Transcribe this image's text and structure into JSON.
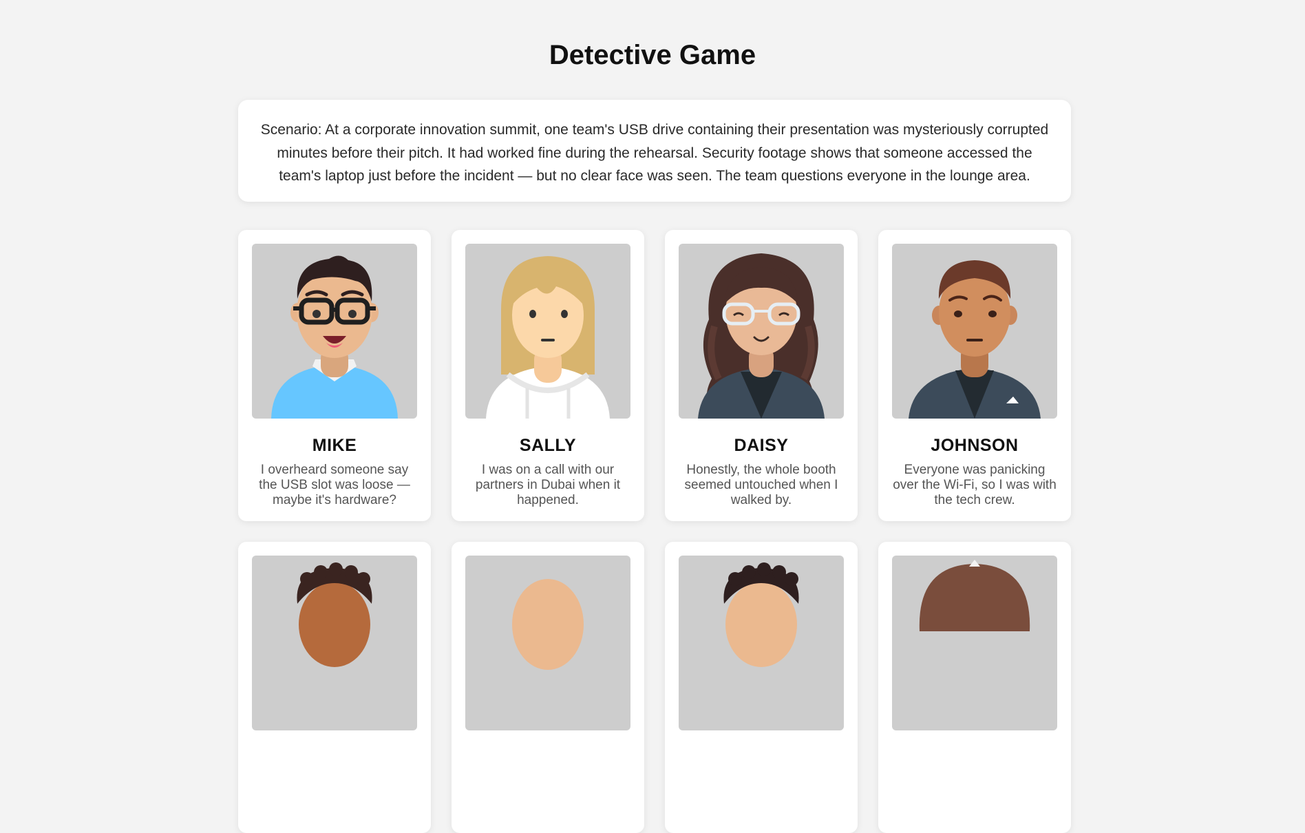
{
  "title": "Detective Game",
  "scenario": "Scenario: At a corporate innovation summit, one team's USB drive containing their presentation was mysteriously corrupted minutes before their pitch. It had worked fine during the rehearsal. Security footage shows that someone accessed the team's laptop just before the incident — but no clear face was seen. The team questions everyone in the lounge area.",
  "suspects": [
    {
      "name": "MIKE",
      "statement": "I overheard someone say the USB slot was loose — maybe it's hardware?",
      "avatar": "man-glasses-blue-sweater-avatar"
    },
    {
      "name": "SALLY",
      "statement": "I was on a call with our partners in Dubai when it happened.",
      "avatar": "blonde-woman-white-hoodie-avatar"
    },
    {
      "name": "DAISY",
      "statement": "Honestly, the whole booth seemed untouched when I walked by.",
      "avatar": "curly-hair-woman-glasses-avatar"
    },
    {
      "name": "JOHNSON",
      "statement": "Everyone was panicking over the Wi-Fi, so I was with the tech crew.",
      "avatar": "man-dark-blazer-avatar"
    }
  ],
  "colors": {
    "background": "#f3f3f3",
    "card": "#ffffff",
    "portrait_bg": "#cdcdcd",
    "mike_sweater": "#66c6ff",
    "jacket": "#3c4b5a"
  }
}
